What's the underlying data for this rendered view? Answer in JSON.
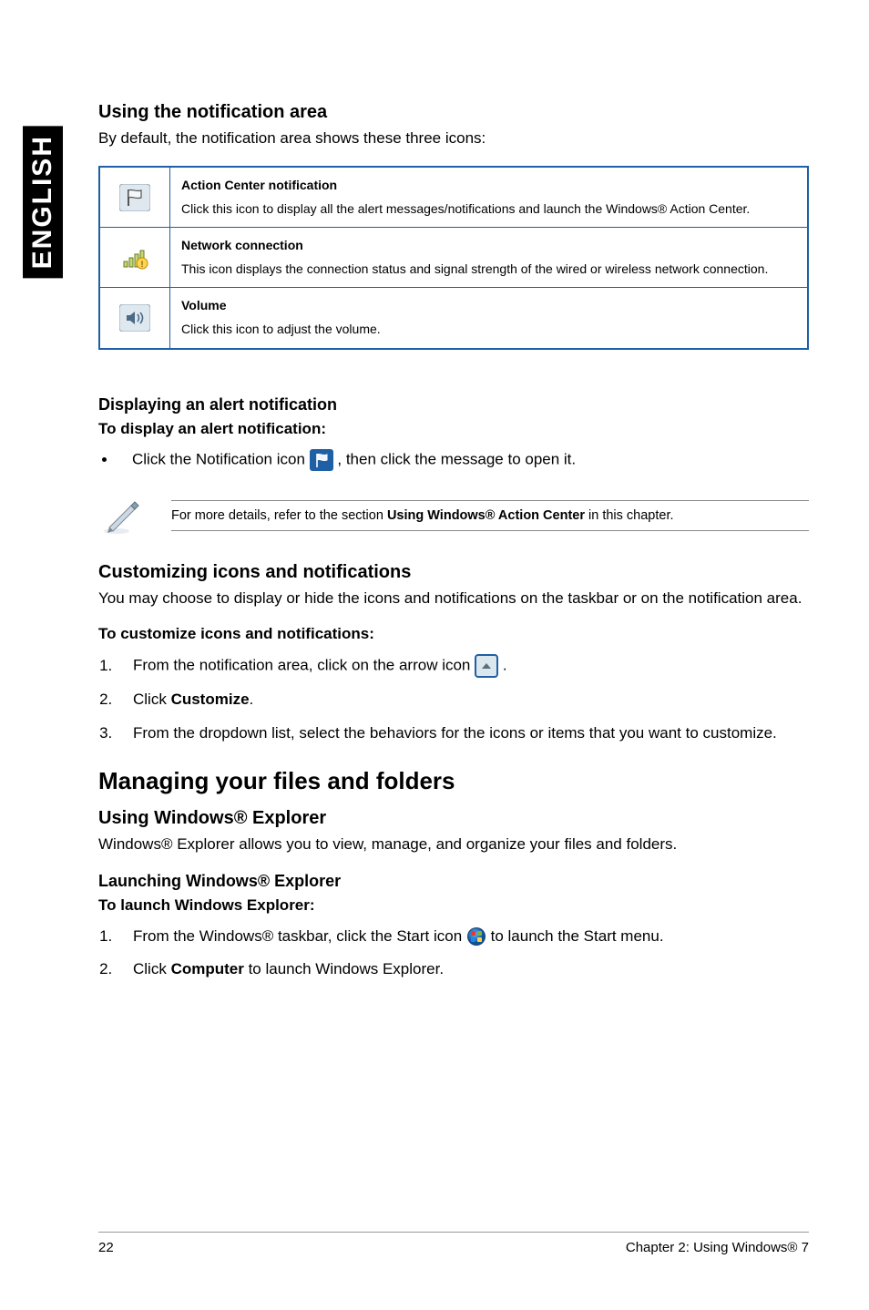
{
  "sidebar": {
    "label": "ENGLISH"
  },
  "sec1": {
    "title": "Using the notification area",
    "intro": "By default, the notification area shows these three icons:",
    "rows": [
      {
        "title": "Action Center notification",
        "desc": "Click this icon to display all the alert messages/notifications and launch the Windows® Action Center."
      },
      {
        "title": "Network connection",
        "desc": "This icon displays the connection status and signal strength of the wired or wireless network connection."
      },
      {
        "title": "Volume",
        "desc": "Click this icon to adjust the volume."
      }
    ]
  },
  "sec2": {
    "title": "Displaying an alert notification",
    "sub": "To display an alert notification:",
    "bullet_a": "Click the Notification icon ",
    "bullet_b": ", then click the message to open it.",
    "note_a": "For more details, refer to the section ",
    "note_b": "Using Windows® Action Center",
    "note_c": " in this chapter."
  },
  "sec3": {
    "title": "Customizing icons and notifications",
    "intro": "You may choose to display or hide the icons and notifications on the taskbar or on the notification area.",
    "sub": "To customize icons and notifications:",
    "step1_a": "From the notification area, click on the arrow icon ",
    "step1_b": ".",
    "step2_a": "Click ",
    "step2_b": "Customize",
    "step2_c": ".",
    "step3": "From the dropdown list, select the behaviors for the icons or items that you want to customize."
  },
  "sec4": {
    "title": "Managing your files and folders",
    "h1": "Using Windows® Explorer",
    "p1": "Windows® Explorer allows you to view, manage, and organize your files and folders.",
    "h2": "Launching Windows® Explorer",
    "sub": "To launch Windows Explorer:",
    "step1_a": "From the Windows® taskbar, click the Start icon ",
    "step1_b": " to launch the Start menu.",
    "step2_a": "Click ",
    "step2_b": "Computer",
    "step2_c": " to launch Windows Explorer."
  },
  "footer": {
    "page": "22",
    "chapter": "Chapter 2: Using Windows® 7"
  }
}
